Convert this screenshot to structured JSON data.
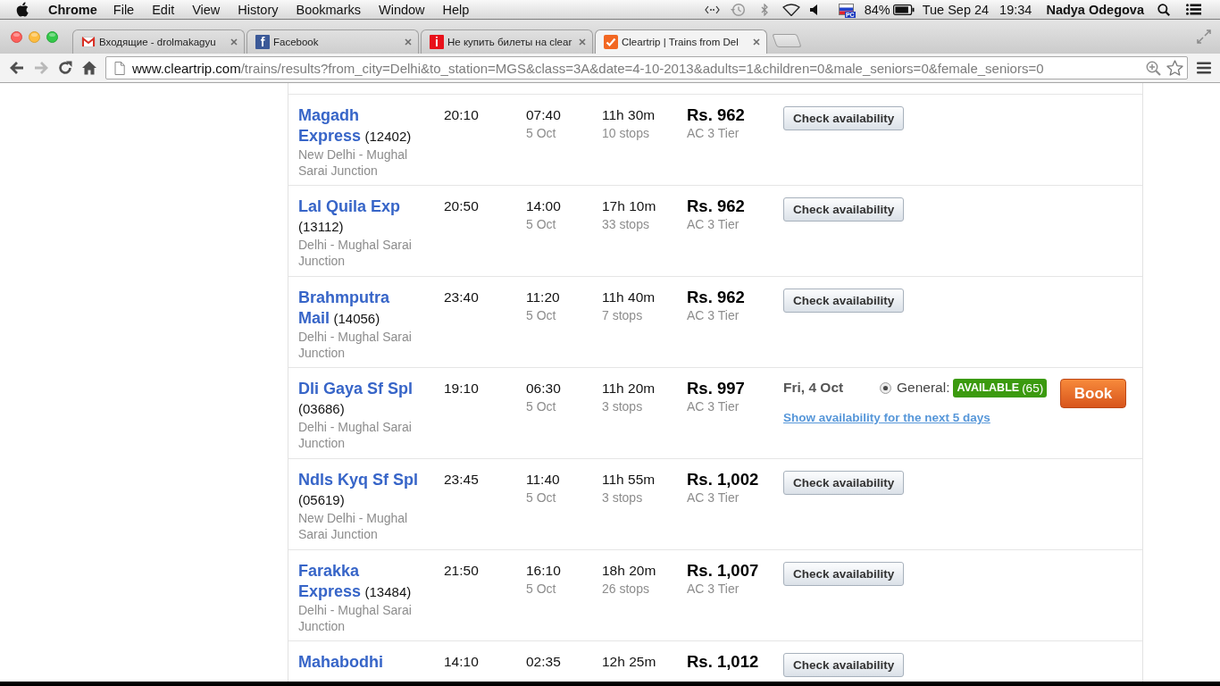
{
  "menu_bar": {
    "app": "Chrome",
    "menus": [
      "File",
      "Edit",
      "View",
      "History",
      "Bookmarks",
      "Window",
      "Help"
    ],
    "input_source": "PC",
    "battery": "84%",
    "date": "Tue Sep 24",
    "time": "19:34",
    "user": "Nadya Odegova"
  },
  "tabs": [
    {
      "kind": "mail",
      "title": "Входящие - drolmakagyu",
      "selected": false
    },
    {
      "kind": "letter",
      "favicon_text": "f",
      "color": "#3b5998",
      "title": "Facebook",
      "selected": false
    },
    {
      "kind": "letter",
      "favicon_text": "i",
      "color": "#e8101a",
      "title": "Не купить билеты на clear",
      "selected": false
    },
    {
      "kind": "tick",
      "title": "Cleartrip | Trains from Del",
      "selected": true
    }
  ],
  "toolbar": {
    "nav": [
      {
        "kind": "back",
        "disabled": false
      },
      {
        "kind": "forward",
        "disabled": true
      },
      {
        "kind": "reload",
        "disabled": false
      },
      {
        "kind": "home",
        "disabled": false
      }
    ],
    "url": {
      "host": "www.cleartrip.com",
      "path": "/trains/results?from_city=Delhi&to_station=MGS&class=3A&date=4-10-2013&adults=1&children=0&male_seniors=0&female_seniors=0"
    }
  },
  "results": [
    {
      "name": "Magadh Express",
      "number": "(12402)",
      "route": "New Delhi - Mughal Sarai Junction",
      "departs": "20:10",
      "arrives": "07:40",
      "arrival_date": "5 Oct",
      "duration": "11h 30m",
      "stops": "10 stops",
      "price": "Rs. 962",
      "class": "AC 3 Tier",
      "action": {
        "kind": "button",
        "label": "Check availability"
      }
    },
    {
      "name": "Lal Quila Exp",
      "number": "(13112)",
      "route": "Delhi - Mughal Sarai Junction",
      "departs": "20:50",
      "arrives": "14:00",
      "arrival_date": "5 Oct",
      "duration": "17h 10m",
      "stops": "33 stops",
      "price": "Rs. 962",
      "class": "AC 3 Tier",
      "action": {
        "kind": "button",
        "label": "Check availability"
      }
    },
    {
      "name": "Brahmputra Mail",
      "number": "(14056)",
      "route": "Delhi - Mughal Sarai Junction",
      "departs": "23:40",
      "arrives": "11:20",
      "arrival_date": "5 Oct",
      "duration": "11h 40m",
      "stops": "7 stops",
      "price": "Rs. 962",
      "class": "AC 3 Tier",
      "action": {
        "kind": "button",
        "label": "Check availability"
      }
    },
    {
      "name": "Dli Gaya Sf Spl",
      "number": "(03686)",
      "route": "Delhi - Mughal Sarai Junction",
      "departs": "19:10",
      "arrives": "06:30",
      "arrival_date": "5 Oct",
      "duration": "11h 20m",
      "stops": "3 stops",
      "price": "Rs. 997",
      "class": "AC 3 Tier",
      "action": {
        "kind": "availability",
        "date": "Fri, 4 Oct",
        "selected": true,
        "quota": "General:",
        "status": "AVAILABLE",
        "seats": "(65)",
        "link": "Show availability for the next 5 days",
        "book": "Book"
      }
    },
    {
      "name": "Ndls Kyq Sf Spl",
      "number": "(05619)",
      "route": "New Delhi - Mughal Sarai Junction",
      "departs": "23:45",
      "arrives": "11:40",
      "arrival_date": "5 Oct",
      "duration": "11h 55m",
      "stops": "3 stops",
      "price": "Rs. 1,002",
      "class": "AC 3 Tier",
      "action": {
        "kind": "button",
        "label": "Check availability"
      }
    },
    {
      "name": "Farakka Express",
      "number": "(13484)",
      "route": "Delhi - Mughal Sarai Junction",
      "departs": "21:50",
      "arrives": "16:10",
      "arrival_date": "5 Oct",
      "duration": "18h 20m",
      "stops": "26 stops",
      "price": "Rs. 1,007",
      "class": "AC 3 Tier",
      "action": {
        "kind": "button",
        "label": "Check availability"
      }
    },
    {
      "name": "Mahabodhi",
      "departs": "14:10",
      "arrives": "02:35",
      "duration": "12h 25m",
      "price": "Rs. 1,012",
      "action": {
        "kind": "button",
        "label": "Check availability"
      }
    }
  ]
}
